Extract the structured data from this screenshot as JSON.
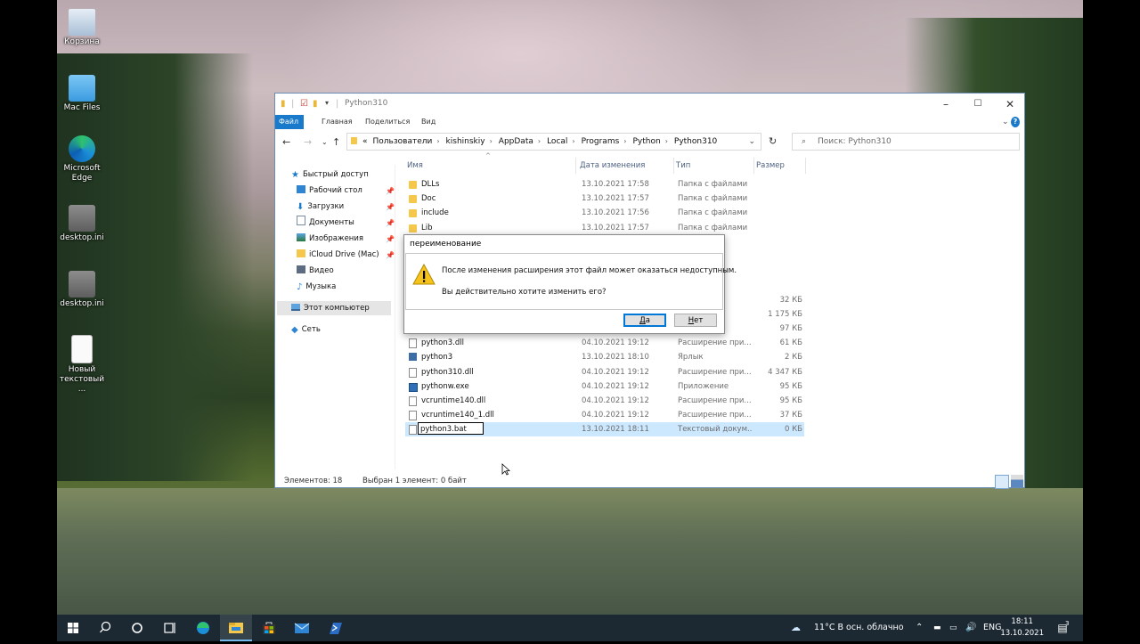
{
  "desktop": {
    "icons": [
      {
        "label": "Корзина",
        "icon": "recycle-bin-icon"
      },
      {
        "label": "Mac Files",
        "icon": "folder-icon"
      },
      {
        "label": "Microsoft Edge",
        "icon": "edge-icon"
      },
      {
        "label": "desktop.ini",
        "icon": "gear-file-icon"
      },
      {
        "label": "desktop.ini",
        "icon": "gear-file-icon"
      },
      {
        "label": "Новый текстовый ...",
        "icon": "text-file-icon"
      }
    ]
  },
  "explorer": {
    "title": "Python310",
    "tabs": [
      "Файл",
      "Главная",
      "Поделиться",
      "Вид"
    ],
    "address": {
      "prefix": "«",
      "crumbs": [
        "Пользователи",
        "kishinskiy",
        "AppData",
        "Local",
        "Programs",
        "Python",
        "Python310"
      ]
    },
    "search_placeholder": "Поиск: Python310",
    "nav": {
      "items": [
        {
          "label": "Быстрый доступ",
          "icon": "star-icon",
          "pinned": false
        },
        {
          "label": "Рабочий стол",
          "icon": "desktop-folder-icon",
          "pinned": true
        },
        {
          "label": "Загрузки",
          "icon": "downloads-icon",
          "pinned": true
        },
        {
          "label": "Документы",
          "icon": "documents-icon",
          "pinned": true
        },
        {
          "label": "Изображения",
          "icon": "pictures-icon",
          "pinned": true
        },
        {
          "label": "iCloud Drive (Mac)",
          "icon": "cloud-folder-icon",
          "pinned": true
        },
        {
          "label": "Видео",
          "icon": "video-icon",
          "pinned": false
        },
        {
          "label": "Музыка",
          "icon": "music-icon",
          "pinned": false
        },
        {
          "label": "Этот компьютер",
          "icon": "computer-icon",
          "pinned": false,
          "selected": true
        },
        {
          "label": "Сеть",
          "icon": "network-icon",
          "pinned": false
        }
      ]
    },
    "columns": [
      "Имя",
      "Дата изменения",
      "Тип",
      "Размер"
    ],
    "rows": [
      {
        "name": "DLLs",
        "date": "13.10.2021 17:58",
        "type": "Папка с файлами",
        "size": "",
        "icon": "folder"
      },
      {
        "name": "Doc",
        "date": "13.10.2021 17:57",
        "type": "Папка с файлами",
        "size": "",
        "icon": "folder"
      },
      {
        "name": "include",
        "date": "13.10.2021 17:56",
        "type": "Папка с файлами",
        "size": "",
        "icon": "folder"
      },
      {
        "name": "Lib",
        "date": "13.10.2021 17:57",
        "type": "Папка с файлами",
        "size": "",
        "icon": "folder"
      },
      {
        "name": "",
        "date": "",
        "type": "алми",
        "size": "",
        "icon": "none"
      },
      {
        "name": "",
        "date": "",
        "type": "алми",
        "size": "",
        "icon": "none"
      },
      {
        "name": "",
        "date": "",
        "type": "алми",
        "size": "",
        "icon": "none"
      },
      {
        "name": "",
        "date": "",
        "type": "алми",
        "size": "",
        "icon": "none"
      },
      {
        "name": "",
        "date": "",
        "type": "",
        "size": "32 КБ",
        "icon": "none"
      },
      {
        "name": "",
        "date": "",
        "type": "окум...",
        "size": "1 175 КБ",
        "icon": "none"
      },
      {
        "name": "",
        "date": "",
        "type": "",
        "size": "97 КБ",
        "icon": "none"
      },
      {
        "name": "python3.dll",
        "date": "04.10.2021 19:12",
        "type": "Расширение при...",
        "size": "61 КБ",
        "icon": "file"
      },
      {
        "name": "python3",
        "date": "13.10.2021 18:10",
        "type": "Ярлык",
        "size": "2 КБ",
        "icon": "link"
      },
      {
        "name": "python310.dll",
        "date": "04.10.2021 19:12",
        "type": "Расширение при...",
        "size": "4 347 КБ",
        "icon": "file"
      },
      {
        "name": "pythonw.exe",
        "date": "04.10.2021 19:12",
        "type": "Приложение",
        "size": "95 КБ",
        "icon": "exe"
      },
      {
        "name": "vcruntime140.dll",
        "date": "04.10.2021 19:12",
        "type": "Расширение при...",
        "size": "95 КБ",
        "icon": "file"
      },
      {
        "name": "vcruntime140_1.dll",
        "date": "04.10.2021 19:12",
        "type": "Расширение при...",
        "size": "37 КБ",
        "icon": "file"
      },
      {
        "name": "python3.bat",
        "date": "13.10.2021 18:11",
        "type": "Текстовый докум...",
        "size": "0 КБ",
        "icon": "file",
        "selected": true,
        "renaming": true
      }
    ],
    "status": {
      "count": "Элементов: 18",
      "selection": "Выбран 1 элемент: 0 байт"
    }
  },
  "dialog": {
    "title": "переименование",
    "message": "После изменения расширения этот файл может оказаться недоступным.",
    "question": "Вы действительно хотите изменить его?",
    "yes_label_u": "Д",
    "yes_label_rest": "а",
    "no_label_u": "Н",
    "no_label_rest": "ет"
  },
  "taskbar": {
    "weather": "11°C  В осн. облачно",
    "lang": "ENG",
    "time": "18:11",
    "date": "13.10.2021",
    "notifications": "3"
  }
}
